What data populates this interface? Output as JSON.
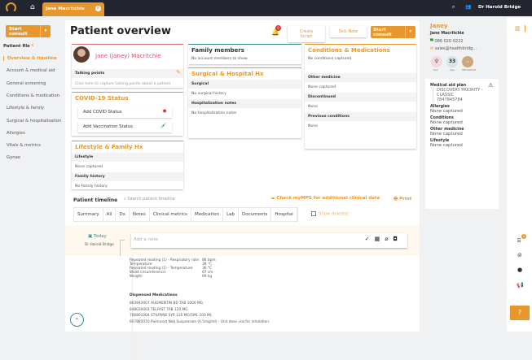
{
  "topbar": {
    "patient_tab": "Jane Macritchie",
    "user": "Dr Harold Bridge"
  },
  "sidebar": {
    "start_consult": "Start consult",
    "section": "Patient file",
    "items": [
      {
        "label": "Overview & timeline",
        "active": true
      },
      {
        "label": "Account & medical aid"
      },
      {
        "label": "General screening"
      },
      {
        "label": "Conditions & medication"
      },
      {
        "label": "Lifestyle & family"
      },
      {
        "label": "Surgical & hospitalisation"
      },
      {
        "label": "Allergies"
      },
      {
        "label": "Vitals & metrics"
      },
      {
        "label": "Gynae"
      }
    ]
  },
  "header": {
    "title": "Patient overview",
    "notification_count": "0",
    "create_script": "Create Script",
    "sick_note": "Sick Note",
    "start_consult": "Start consult"
  },
  "profile": {
    "name": "Jane (Janey) Macritchie",
    "talking_points": "Talking points",
    "talking_points_placeholder": "Click here to capture talking points about a patient"
  },
  "covid": {
    "title": "COVID-19 Status",
    "add_covid": "Add COVID Status",
    "add_vaccination": "Add Vaccination Status"
  },
  "lifestyle": {
    "title": "Lifestyle & Family Hx",
    "lifestyle_label": "Lifestyle",
    "lifestyle_value": "None captured",
    "family_label": "Family history",
    "family_value": "No Family history"
  },
  "family": {
    "title": "Family members",
    "value": "No account members to show"
  },
  "surgical": {
    "title": "Surgical & Hospital Hx",
    "surgical_label": "Surgical",
    "surgical_value": "No surgical history",
    "hosp_label": "Hospitalization notes",
    "hosp_value": "No hospitalization notes"
  },
  "conditions": {
    "title": "Conditions & Medications",
    "value": "No conditions captured",
    "other_label": "Other medicine",
    "other_value": "None captured",
    "disc_label": "Discontinued",
    "disc_value": "None",
    "prev_label": "Previous conditions",
    "prev_value": "None"
  },
  "timeline": {
    "title": "Patient timeline",
    "search_placeholder": "Search patient timeline",
    "mymps": "Check myMPS for additional clinical data",
    "print": "Print",
    "tabs": [
      "Summary",
      "All",
      "Dx",
      "Notes",
      "Clinical metrics",
      "Medication",
      "Lab",
      "Documents",
      "Hospital"
    ],
    "show_deleted": "Show deleted",
    "date": "Today",
    "doctor": "Dr Harold Bridge",
    "note_placeholder": "Add a note",
    "vitals": [
      [
        "Repeated reading (1) - Respiratory rate:",
        "86 bpm"
      ],
      [
        "Temperature:",
        "39 °C"
      ],
      [
        "Repeated reading (1) - Temperature:",
        "36 °C"
      ],
      [
        "Waist circumference:",
        "67 cm"
      ],
      [
        "Weight:",
        "69 kg"
      ]
    ],
    "dispensed_title": "Dispensed Medications",
    "medications": [
      "863942007 AUGMENTIN BD TAB 1000 MG",
      "848030003 TELFAST TAB 120 MG",
      "766801004 STILPANE SYR 120 MG/5ML 100 ML",
      "807885010 Pulmicort Neb Suspension (0.5mg/ml) - Unit dose vial for inhalation"
    ]
  },
  "right_panel": {
    "nickname": "Janey",
    "full_name": "Jane Macritchie",
    "phone": "086 020 0222",
    "email": "sales@healthbridg...",
    "sex_label": "Sex",
    "age": "33",
    "age_label": "Age",
    "hid_label": "HBHealthID",
    "medical_aid_label": "Medical aid plan",
    "medical_aid": "DISCOVERY PRIORITY - CLASSIC",
    "medical_aid_number": "7847845784",
    "fields": [
      {
        "label": "Allergies",
        "value": "None captured"
      },
      {
        "label": "Conditions",
        "value": "None captured"
      },
      {
        "label": "Other medicine",
        "value": "None captured"
      },
      {
        "label": "Lifestyle",
        "value": "None captured"
      }
    ]
  },
  "rail": {
    "badge": "0"
  },
  "colors": {
    "accent": "#e8972e",
    "topbar": "#23262e",
    "profile_name": "#c9566a",
    "teal": "#3a8d96"
  }
}
